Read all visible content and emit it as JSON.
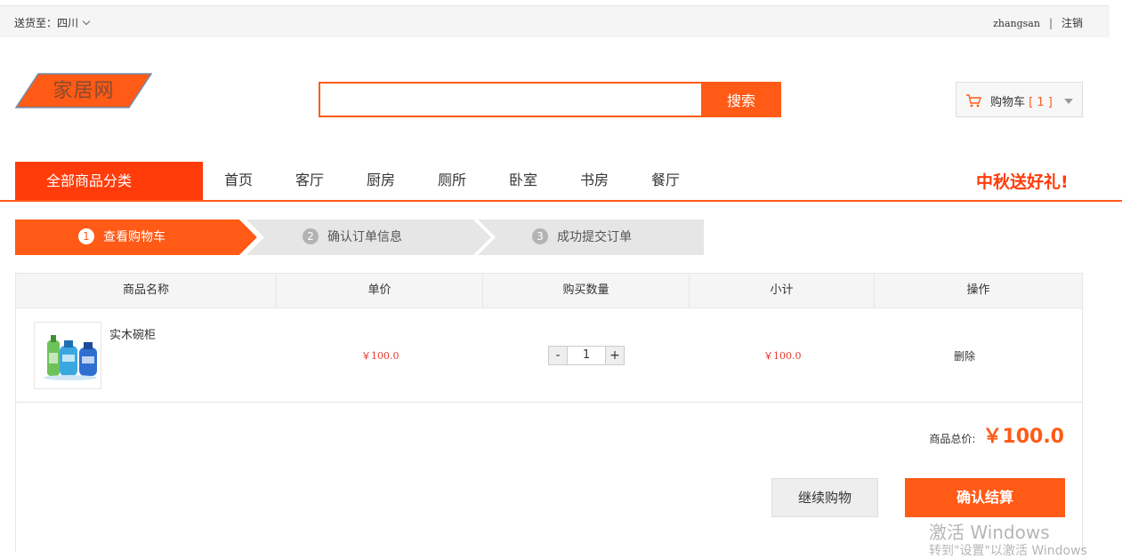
{
  "topbar": {
    "ship_to": "送货至：四川",
    "username": "zhangsan",
    "separator": "|",
    "logout": "注销"
  },
  "header": {
    "logo_text": "家居网",
    "search_placeholder": "",
    "search_button": "搜索",
    "cart_label": "购物车",
    "cart_count_text": "[ 1 ]"
  },
  "nav": {
    "all_categories": "全部商品分类",
    "items": [
      "首页",
      "客厅",
      "厨房",
      "厕所",
      "卧室",
      "书房",
      "餐厅"
    ],
    "promo": "中秋送好礼!"
  },
  "steps": [
    {
      "num": "1",
      "label": "查看购物车"
    },
    {
      "num": "2",
      "label": "确认订单信息"
    },
    {
      "num": "3",
      "label": "成功提交订单"
    }
  ],
  "table": {
    "headers": [
      "商品名称",
      "单价",
      "购买数量",
      "小计",
      "操作"
    ],
    "rows": [
      {
        "name": "实木碗柜",
        "price": "￥100.0",
        "quantity": "1",
        "subtotal": "￥100.0",
        "action": "删除"
      }
    ]
  },
  "stepper": {
    "minus": "-",
    "plus": "+"
  },
  "summary": {
    "total_label": "商品总价:",
    "total_value": "￥100.0",
    "continue_button": "继续购物",
    "checkout_button": "确认结算"
  },
  "watermark": {
    "line1": "激活 Windows",
    "line2": "转到\"设置\"以激活 Windows"
  },
  "colors": {
    "accent": "#ff5a16",
    "nav_red": "#ff3c0a",
    "price_red": "#e4392c"
  },
  "icons": [
    "chevron-down-icon",
    "cart-icon",
    "caret-down-icon",
    "product-thumbnail"
  ]
}
